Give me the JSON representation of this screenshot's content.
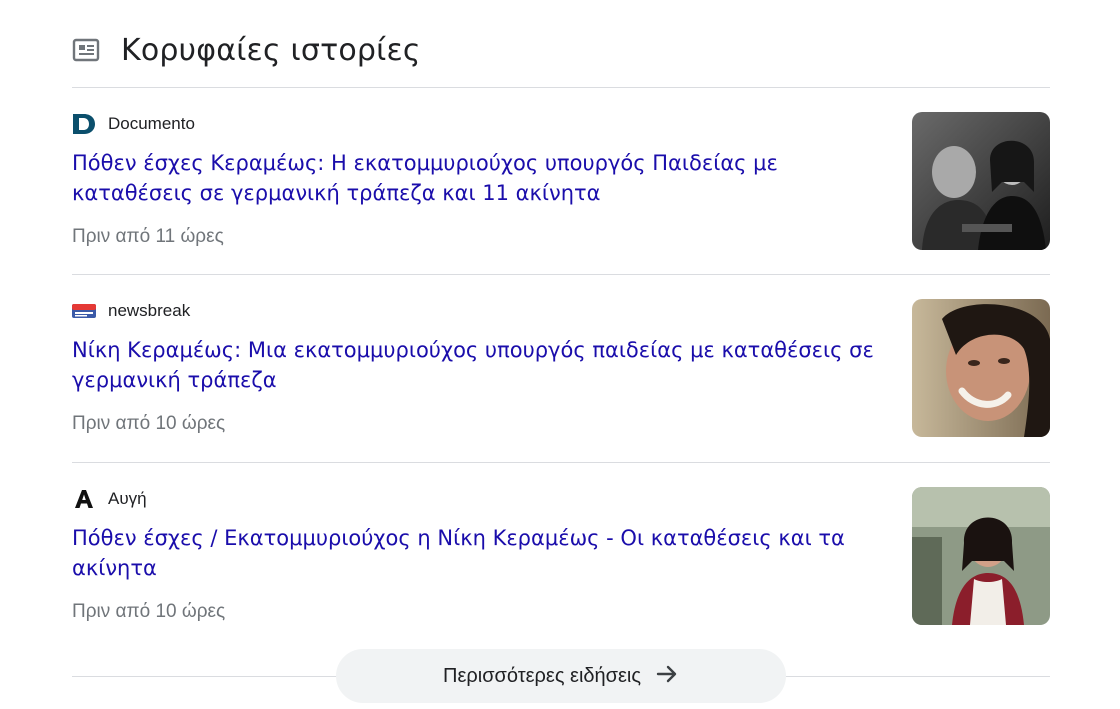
{
  "section": {
    "title": "Κορυφαίες ιστορίες",
    "icon": "newspaper-icon"
  },
  "stories": [
    {
      "source": "Documento",
      "logo_icon": "documento-logo-icon",
      "headline": "Πόθεν έσχες Κεραμέως: Η εκατομμυριούχος υπουργός Παιδείας με καταθέσεις σε γερμανική τράπεζα και 11 ακίνητα",
      "time": "Πριν από 11 ώρες"
    },
    {
      "source": "newsbreak",
      "logo_icon": "newsbreak-logo-icon",
      "headline": "Νίκη Κεραμέως: Μια εκατομμυριούχος υπουργός παιδείας με καταθέσεις σε γερμανική τράπεζα",
      "time": "Πριν από 10 ώρες"
    },
    {
      "source": "Αυγή",
      "logo_icon": "avgi-logo-icon",
      "headline": "Πόθεν έσχες / Εκατομμυριούχος η Νίκη Κεραμέως - Οι καταθέσεις και τα ακίνητα",
      "time": "Πριν από 10 ώρες"
    }
  ],
  "more_button": {
    "label": "Περισσότερες ειδήσεις",
    "icon": "arrow-right-icon"
  },
  "colors": {
    "link": "#1a0dab",
    "meta": "#70757a",
    "divider": "#dadce0"
  }
}
